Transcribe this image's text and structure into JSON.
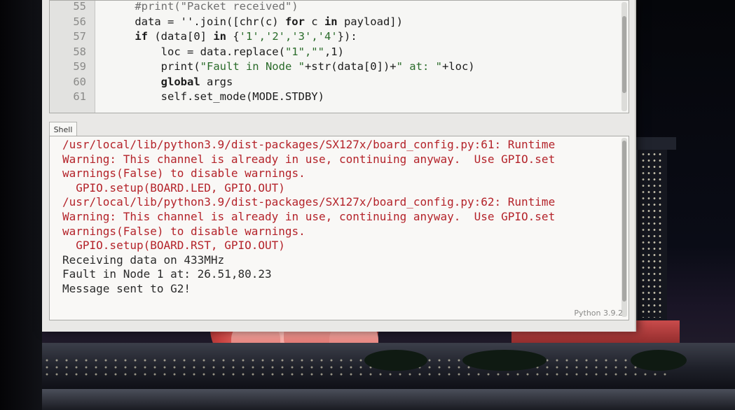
{
  "editor": {
    "lines": [
      {
        "num": "55",
        "indent": "    ",
        "parts": [
          {
            "t": "#print(\"Packet received\")",
            "c": "cmt"
          }
        ]
      },
      {
        "num": "56",
        "indent": "    ",
        "parts": [
          {
            "t": "data = ''.join([chr(c) ",
            "c": ""
          },
          {
            "t": "for",
            "c": "kw"
          },
          {
            "t": " c ",
            "c": ""
          },
          {
            "t": "in",
            "c": "kw"
          },
          {
            "t": " payload])",
            "c": ""
          }
        ]
      },
      {
        "num": "57",
        "indent": "    ",
        "parts": [
          {
            "t": "if",
            "c": "kw"
          },
          {
            "t": " (data[0] ",
            "c": ""
          },
          {
            "t": "in",
            "c": "kw"
          },
          {
            "t": " {",
            "c": ""
          },
          {
            "t": "'1','2','3','4'",
            "c": "str"
          },
          {
            "t": "}):",
            "c": ""
          }
        ]
      },
      {
        "num": "58",
        "indent": "        ",
        "parts": [
          {
            "t": "loc = data.replace(",
            "c": ""
          },
          {
            "t": "\"1\",\"\"",
            "c": "str"
          },
          {
            "t": ",1)",
            "c": ""
          }
        ]
      },
      {
        "num": "59",
        "indent": "        ",
        "parts": [
          {
            "t": "print(",
            "c": ""
          },
          {
            "t": "\"Fault in Node \"",
            "c": "str"
          },
          {
            "t": "+str(data[0])+",
            "c": ""
          },
          {
            "t": "\" at: \"",
            "c": "str"
          },
          {
            "t": "+loc)",
            "c": ""
          }
        ]
      },
      {
        "num": "60",
        "indent": "        ",
        "parts": [
          {
            "t": "global",
            "c": "kw"
          },
          {
            "t": " args",
            "c": ""
          }
        ]
      },
      {
        "num": "61",
        "indent": "        ",
        "parts": [
          {
            "t": "self.set_mode(MODE.STDBY)",
            "c": ""
          }
        ]
      }
    ]
  },
  "shell": {
    "tab_label": "Shell",
    "lines": [
      {
        "text": "/usr/local/lib/python3.9/dist-packages/SX127x/board_config.py:61: Runtime",
        "kind": "err"
      },
      {
        "text": "Warning: This channel is already in use, continuing anyway.  Use GPIO.set",
        "kind": "err"
      },
      {
        "text": "warnings(False) to disable warnings.",
        "kind": "err"
      },
      {
        "text": "  GPIO.setup(BOARD.LED, GPIO.OUT)",
        "kind": "err"
      },
      {
        "text": "/usr/local/lib/python3.9/dist-packages/SX127x/board_config.py:62: Runtime",
        "kind": "err"
      },
      {
        "text": "Warning: This channel is already in use, continuing anyway.  Use GPIO.set",
        "kind": "err"
      },
      {
        "text": "warnings(False) to disable warnings.",
        "kind": "err"
      },
      {
        "text": "  GPIO.setup(BOARD.RST, GPIO.OUT)",
        "kind": "err"
      },
      {
        "text": "Receiving data on 433MHz",
        "kind": "out"
      },
      {
        "text": "Fault in Node 1 at: 26.51,80.23",
        "kind": "out"
      },
      {
        "text": "Message sent to G2!",
        "kind": "out"
      }
    ],
    "status": "Python 3.9.2"
  },
  "colors": {
    "error_text": "#b4232a",
    "output_text": "#2b2b2b",
    "editor_bg": "#f6f6f4"
  }
}
